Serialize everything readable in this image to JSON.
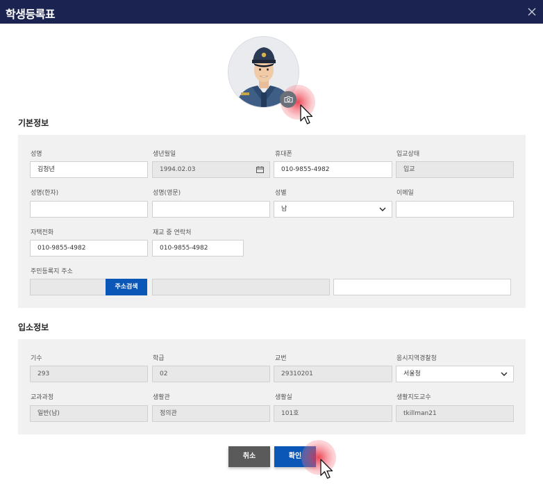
{
  "window": {
    "title": "학생등록표",
    "close_icon": "close-icon"
  },
  "profile": {
    "photo_icon": "person-photo",
    "camera_icon": "camera-icon"
  },
  "basic": {
    "section_title": "기본정보",
    "name_label": "성명",
    "name_value": "김청년",
    "birth_label": "생년월일",
    "birth_value": "1994.02.03",
    "phone_label": "휴대폰",
    "phone_value": "010-9855-4982",
    "admission_status_label": "입교상태",
    "admission_status_value": "입교",
    "name_hanja_label": "성명(한자)",
    "name_hanja_value": "",
    "name_english_label": "성명(영문)",
    "name_english_value": "",
    "gender_label": "성별",
    "gender_value": "남",
    "email_label": "이메일",
    "email_value": "",
    "home_phone_label": "자택전화",
    "home_phone_value": "010-9855-4982",
    "contact_label": "재교 중 연락처",
    "contact_value": "010-9855-4982",
    "address_label": "주민등록지 주소",
    "zipcode_value": "",
    "address_search_label": "주소검색",
    "address_value": "",
    "address_detail_value": ""
  },
  "admission": {
    "section_title": "입소정보",
    "term_label": "기수",
    "term_value": "293",
    "class_label": "학급",
    "class_value": "02",
    "number_label": "교번",
    "number_value": "29310201",
    "police_label": "응시지역경찰청",
    "police_value": "서울청",
    "course_label": "교과과정",
    "course_value": "일반(남)",
    "dorm_label": "생활관",
    "dorm_value": "정의관",
    "room_label": "생활실",
    "room_value": "101호",
    "advisor_label": "생활지도교수",
    "advisor_value": "tkillman21"
  },
  "actions": {
    "cancel_label": "취소",
    "confirm_label": "확인"
  },
  "colors": {
    "titlebar": "#1b2450",
    "primary": "#0b57b8",
    "cancel": "#5a5a5a",
    "panel": "#f1f1f1",
    "click_highlight": "#e8283a"
  }
}
